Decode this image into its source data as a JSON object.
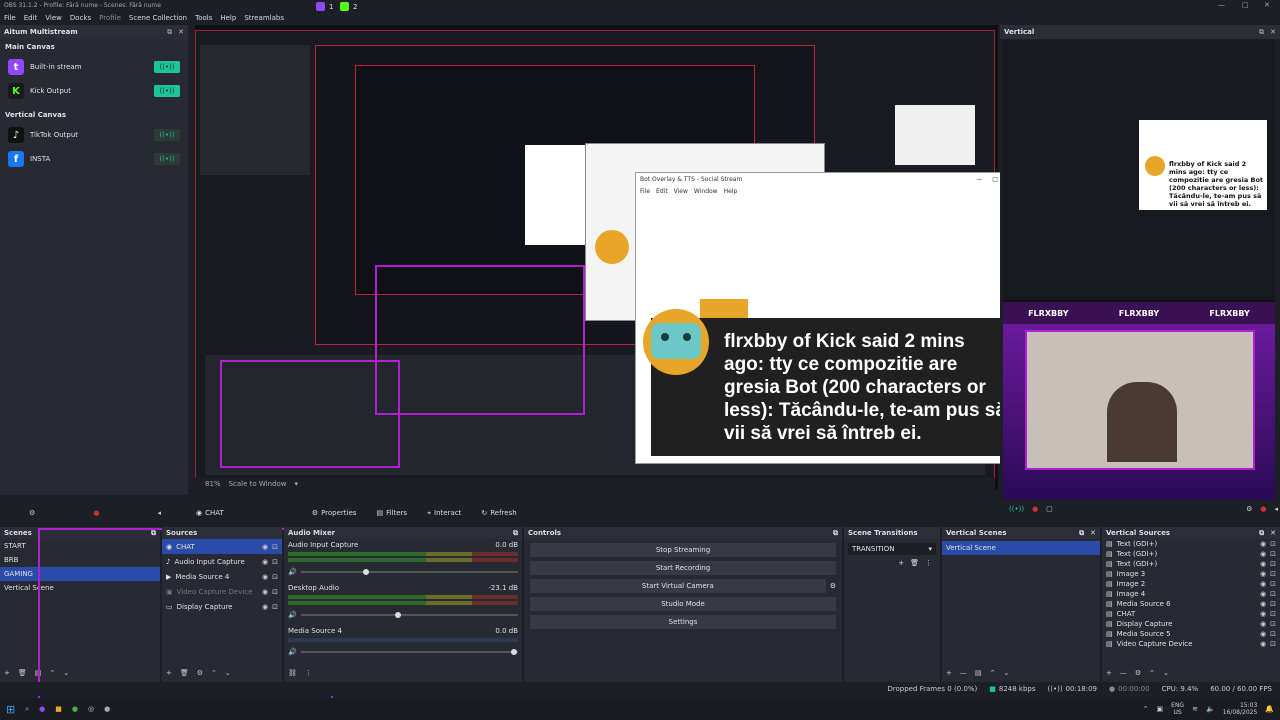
{
  "window": {
    "title": "OBS 31.1.2 - Profile: Fără nume - Scenes: Fără nume",
    "badge1": "1",
    "badge2": "2"
  },
  "menu": [
    "File",
    "Edit",
    "View",
    "Docks",
    "Profile",
    "Scene Collection",
    "Tools",
    "Help",
    "Streamlabs"
  ],
  "aitum": {
    "title": "Aitum Multistream",
    "main_canvas": "Main Canvas",
    "vertical_canvas": "Vertical Canvas",
    "outputs_main": [
      {
        "label": "Built-in stream",
        "icon": "twitch-icon",
        "color": "#9146ff",
        "glyph": "t"
      },
      {
        "label": "Kick Output",
        "icon": "kick-icon",
        "color": "#1a1a1a",
        "glyph": "K"
      }
    ],
    "outputs_vertical": [
      {
        "label": "TikTok Output",
        "icon": "tiktok-icon",
        "color": "#111111",
        "glyph": "♪"
      },
      {
        "label": "INSTA",
        "icon": "facebook-icon",
        "color": "#1877f2",
        "glyph": "f"
      }
    ],
    "toggle_glyph": "((•))"
  },
  "vertical": {
    "title": "Vertical",
    "overlay_text": "flrxbby of Kick said 2 mins ago: tty ce compozitie are gresia Bot (200 characters or less): Tăcându-le, te-am pus să vii să vrei să întreb ei.",
    "banner": "FLRXBBY"
  },
  "popup": {
    "title": "Bot Overlay & TTS - Social Stream",
    "menu": [
      "File",
      "Edit",
      "View",
      "Window",
      "Help"
    ],
    "chat_text": "flrxbby of Kick said 2 mins ago: tty ce compozitie are gresia Bot (200 characters or less): Tăcându-le, te-am pus să vii să vrei să întreb ei."
  },
  "preview_footer": {
    "zoom": "81%",
    "mode": "Scale to Window"
  },
  "source_toolbar": {
    "source": "CHAT",
    "properties": "Properties",
    "filters": "Filters",
    "interact": "Interact",
    "refresh": "Refresh"
  },
  "scenes": {
    "title": "Scenes",
    "items": [
      "START",
      "BRB",
      "GAMING",
      "Vertical Scene"
    ],
    "selected": 2
  },
  "sources": {
    "title": "Sources",
    "items": [
      {
        "name": "CHAT",
        "icon": "browser-source-icon"
      },
      {
        "name": "Audio Input Capture",
        "icon": "microphone-icon"
      },
      {
        "name": "Media Source 4",
        "icon": "play-icon"
      },
      {
        "name": "Video Capture Device",
        "icon": "camera-icon"
      },
      {
        "name": "Display Capture",
        "icon": "monitor-icon"
      }
    ]
  },
  "audio_mixer": {
    "title": "Audio Mixer",
    "channels": [
      {
        "name": "Audio Input Capture",
        "db": "0.0 dB",
        "level": 0.3
      },
      {
        "name": "Desktop Audio",
        "db": "-23.1 dB",
        "level": 0.45
      },
      {
        "name": "Media Source 4",
        "db": "0.0 dB",
        "level": 0.98
      }
    ]
  },
  "controls": {
    "title": "Controls",
    "buttons": [
      "Stop Streaming",
      "Start Recording",
      "Start Virtual Camera",
      "Studio Mode",
      "Settings"
    ]
  },
  "transitions": {
    "title": "Scene Transitions",
    "selected": "TRANSITION"
  },
  "vertical_scenes": {
    "title": "Vertical Scenes",
    "items": [
      "Vertical Scene"
    ]
  },
  "vertical_sources": {
    "title": "Vertical Sources",
    "items": [
      "Text (GDI+)",
      "Text (GDI+)",
      "Text (GDI+)",
      "Image 3",
      "Image 2",
      "Image 4",
      "Media Source 6",
      "CHAT",
      "Display Capture",
      "Media Source 5",
      "Video Capture Device"
    ]
  },
  "status": {
    "dropped": "Dropped Frames 0 (0.0%)",
    "bitrate": "8248 kbps",
    "stream_time": "00:18:09",
    "rec_time": "00:00:00",
    "cpu": "CPU: 9.4%",
    "fps": "60.00 / 60.00 FPS"
  },
  "taskbar": {
    "lang1": "ENG",
    "lang2": "US",
    "time": "15:03",
    "date": "16/08/2025"
  },
  "colors": {
    "accent": "#2a4ca8",
    "toggle_on": "#1fc39a",
    "purple": "#b020d0"
  }
}
